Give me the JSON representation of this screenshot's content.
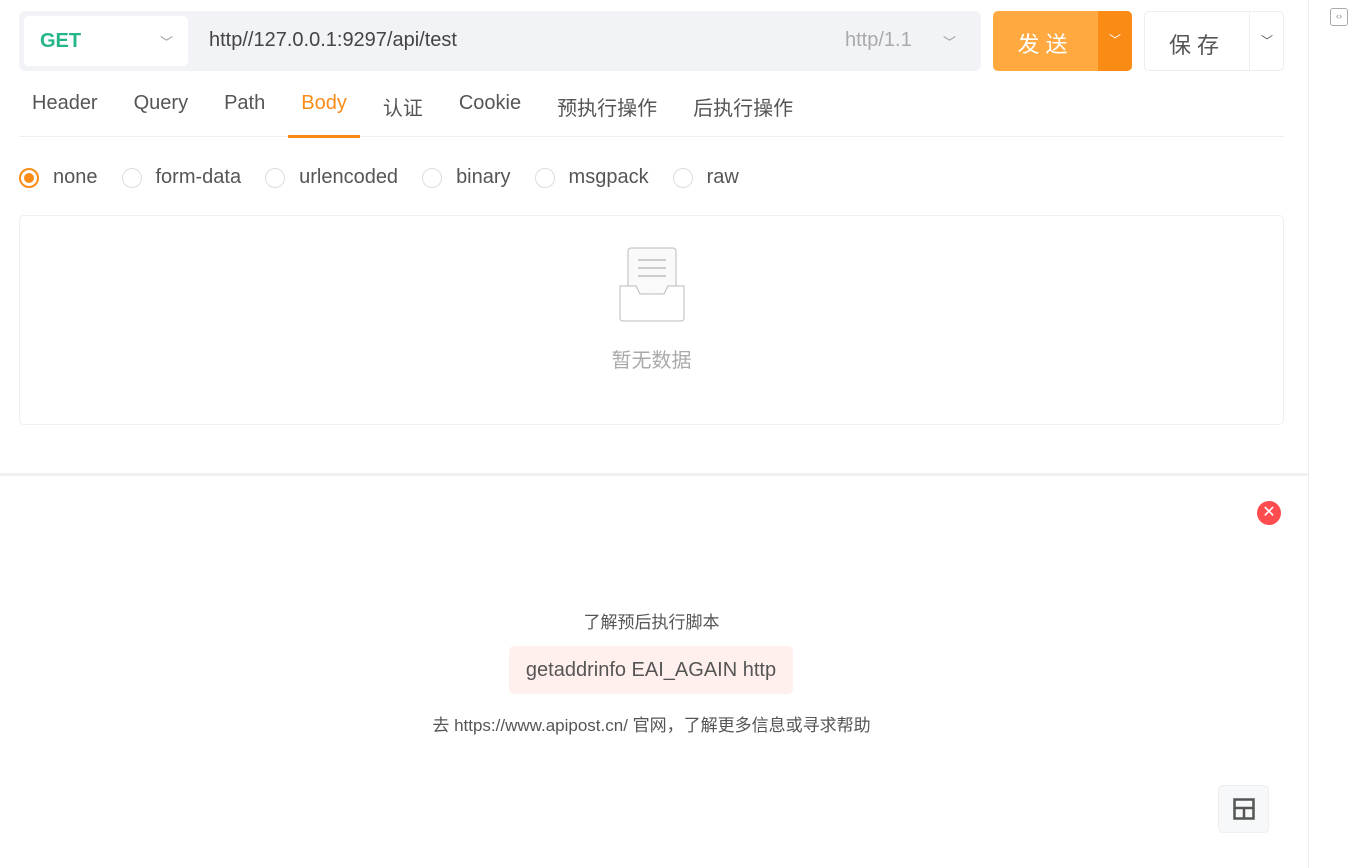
{
  "request": {
    "method": "GET",
    "url": "http//127.0.0.1:9297/api/test",
    "protocol": "http/1.1",
    "send_label": "发送",
    "save_label": "保存"
  },
  "tabs": [
    {
      "label": "Header"
    },
    {
      "label": "Query"
    },
    {
      "label": "Path"
    },
    {
      "label": "Body",
      "active": true
    },
    {
      "label": "认证"
    },
    {
      "label": "Cookie"
    },
    {
      "label": "预执行操作"
    },
    {
      "label": "后执行操作"
    }
  ],
  "body_types": [
    {
      "label": "none",
      "selected": true
    },
    {
      "label": "form-data"
    },
    {
      "label": "urlencoded"
    },
    {
      "label": "binary"
    },
    {
      "label": "msgpack"
    },
    {
      "label": "raw"
    }
  ],
  "empty_text": "暂无数据",
  "response": {
    "learn": "了解预后执行脚本",
    "error": "getaddrinfo EAI_AGAIN http",
    "help": "去 https://www.apipost.cn/ 官网，了解更多信息或寻求帮助"
  },
  "colors": {
    "accent": "#fa8c16",
    "send": "#ffa940",
    "method": "#26b58a",
    "error_bg": "#fff0ee",
    "close": "#ff4d4f"
  }
}
